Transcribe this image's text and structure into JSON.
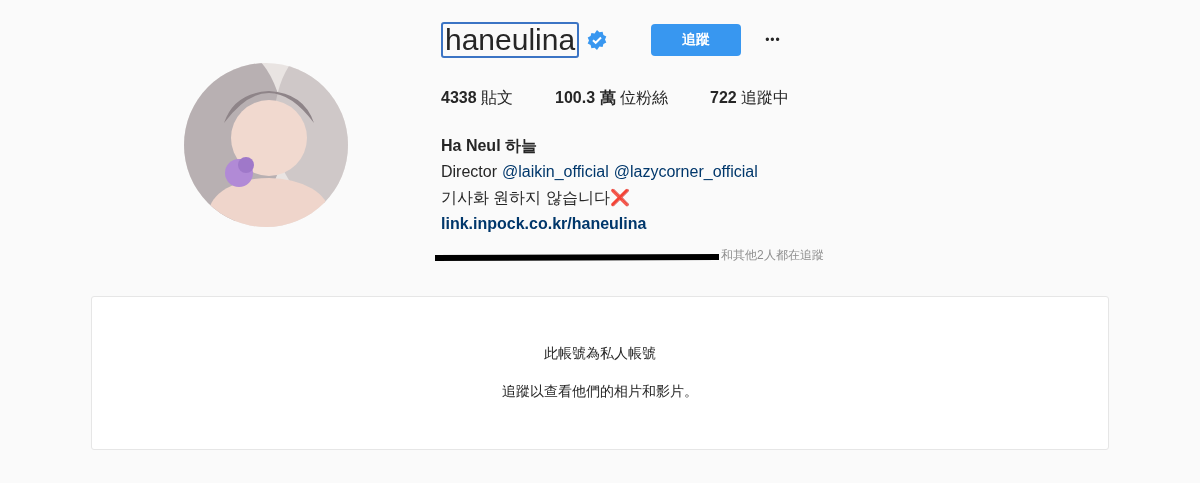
{
  "profile": {
    "username": "haneulina",
    "username_outlined": true,
    "verified": true,
    "follow_button": "追蹤",
    "more_button": "•••"
  },
  "stats": [
    {
      "count": "4338",
      "label": "貼文"
    },
    {
      "count": "100.3 萬",
      "label": "位粉絲"
    },
    {
      "count": "722",
      "label": "追蹤中"
    }
  ],
  "bio": {
    "name": "Ha Neul 하늘",
    "prefix": "Director",
    "mentions": [
      "@laikin_official",
      "@lazycorner_official"
    ],
    "line": "기사화 원하지 않습니다❌",
    "link": "link.inpock.co.kr/haneulina"
  },
  "followed_by": {
    "redacted": true,
    "text": "和其他2人都在追蹤"
  },
  "private_notice": {
    "title": "此帳號為私人帳號",
    "message": "追蹤以查看他們的相片和影片。"
  }
}
